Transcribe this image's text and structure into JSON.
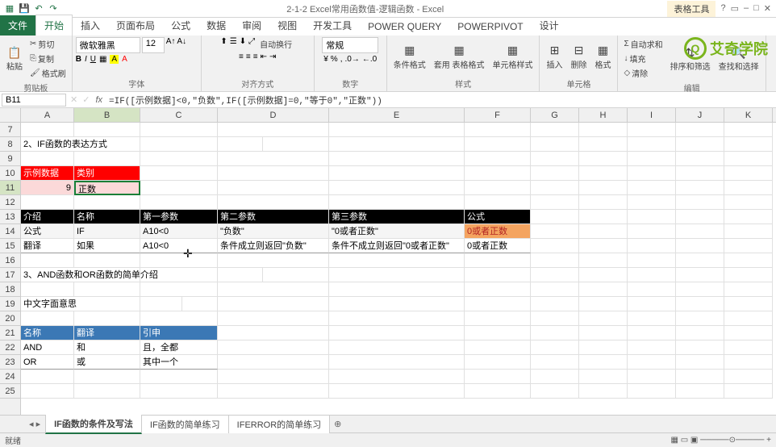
{
  "titlebar": {
    "title": "2-1-2 Excel常用函数值-逻辑函数 - Excel",
    "contextual": "表格工具"
  },
  "tabs": [
    "文件",
    "开始",
    "插入",
    "页面布局",
    "公式",
    "数据",
    "审阅",
    "视图",
    "开发工具",
    "POWER QUERY",
    "POWERPIVOT",
    "设计"
  ],
  "ribbon": {
    "clipboard": {
      "paste": "粘贴",
      "cut": "剪切",
      "copy": "复制",
      "format_painter": "格式刷",
      "label": "剪贴板"
    },
    "font": {
      "name": "微软雅黑",
      "size": "12",
      "label": "字体"
    },
    "align": {
      "wrap": "自动换行",
      "label": "对齐方式"
    },
    "number": {
      "format": "常规",
      "label": "数字"
    },
    "styles": {
      "cond": "条件格式",
      "tbl": "套用\n表格格式",
      "cell": "单元格样式",
      "label": "样式"
    },
    "cells": {
      "insert": "插入",
      "delete": "删除",
      "format": "格式",
      "label": "单元格"
    },
    "editing": {
      "sum": "自动求和",
      "fill": "填充",
      "clear": "清除",
      "sort": "排序和筛选",
      "find": "查找和选择",
      "label": "编辑"
    }
  },
  "logo": "艾奇学院",
  "namebox": "B11",
  "formula": "=IF([示例数据]<0,\"负数\",IF([示例数据]=0,\"等于0\",\"正数\"))",
  "cols": {
    "A": 66,
    "B": 82,
    "C": 96,
    "D": 138,
    "E": 168,
    "F": 82,
    "G": 60,
    "H": 60,
    "I": 60,
    "J": 60,
    "K": 60
  },
  "cells": {
    "A8": "2、IF函数的表达方式",
    "A10": "示例数据",
    "B10": "类别",
    "A11": "9",
    "B11": "正数",
    "A13": "介绍",
    "B13": "名称",
    "C13": "第一参数",
    "D13": "第二参数",
    "E13": "第三参数",
    "F13": "公式",
    "A14": "公式",
    "B14": "IF",
    "C14": "A10<0",
    "D14": "\"负数\"",
    "E14": "\"0或者正数\"",
    "F14": "0或者正数",
    "A15": "翻译",
    "B15": "如果",
    "C15": "A10<0",
    "D15": "条件成立则返回\"负数\"",
    "E15": "条件不成立则返回\"0或者正数\"",
    "F15": "0或者正数",
    "A17": "3、AND函数和OR函数的简单介绍",
    "A19": "中文字面意思",
    "A21": "名称",
    "B21": "翻译",
    "C21": "引申",
    "A22": "AND",
    "B22": "和",
    "C22": "且，全都",
    "A23": "OR",
    "B23": "或",
    "C23": "其中一个"
  },
  "sheets": [
    "IF函数的条件及写法",
    "IF函数的简单练习",
    "IFERROR的简单练习"
  ],
  "status": "就绪"
}
